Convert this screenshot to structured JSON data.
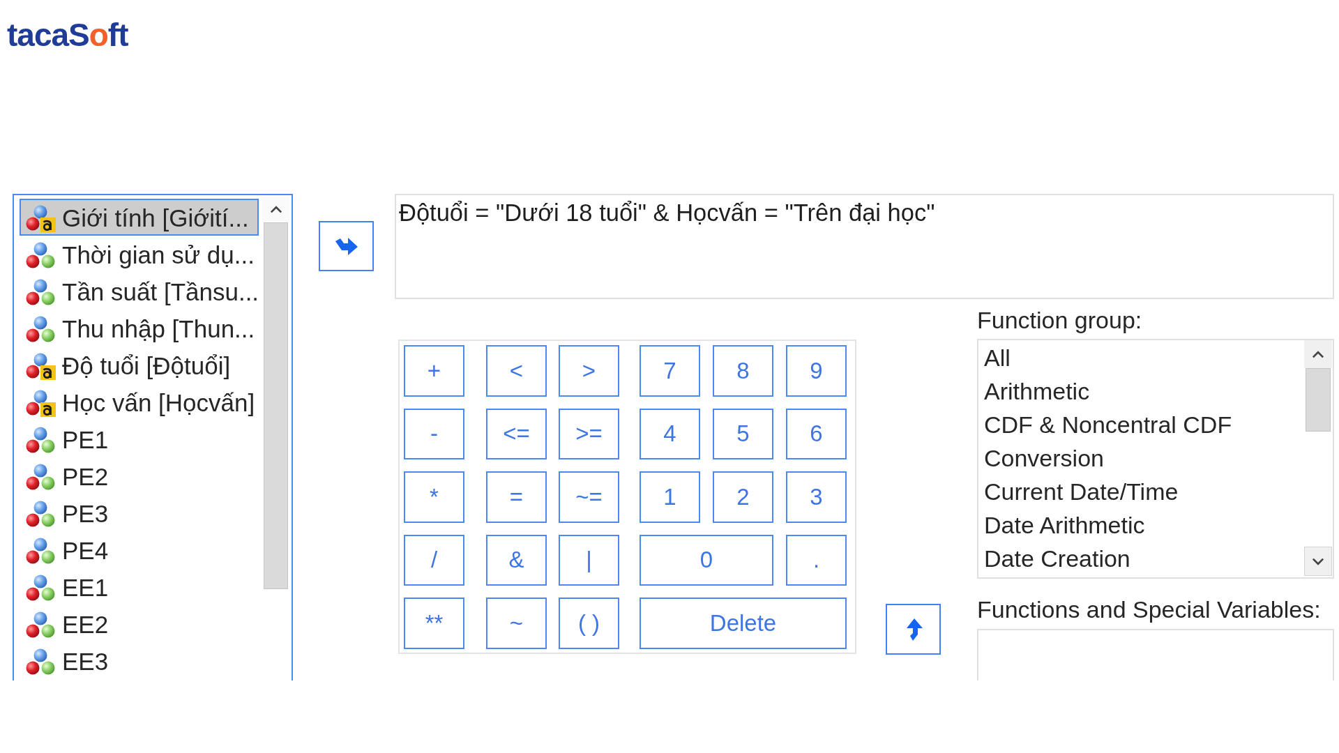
{
  "logo": {
    "text": "tacaSoft"
  },
  "variables": [
    {
      "name": "Giới tính [Giớití...",
      "kind": "string",
      "selected": true
    },
    {
      "name": "Thời gian sử dụ...",
      "kind": "numeric",
      "selected": false
    },
    {
      "name": "Tần suất [Tầnsu...",
      "kind": "numeric",
      "selected": false
    },
    {
      "name": "Thu nhập [Thun...",
      "kind": "numeric",
      "selected": false
    },
    {
      "name": "Độ tuổi [Độtuổi]",
      "kind": "string",
      "selected": false
    },
    {
      "name": "Học vấn [Họcvấn]",
      "kind": "string",
      "selected": false
    },
    {
      "name": "PE1",
      "kind": "numeric",
      "selected": false
    },
    {
      "name": "PE2",
      "kind": "numeric",
      "selected": false
    },
    {
      "name": "PE3",
      "kind": "numeric",
      "selected": false
    },
    {
      "name": "PE4",
      "kind": "numeric",
      "selected": false
    },
    {
      "name": "EE1",
      "kind": "numeric",
      "selected": false
    },
    {
      "name": "EE2",
      "kind": "numeric",
      "selected": false
    },
    {
      "name": "EE3",
      "kind": "numeric",
      "selected": false
    }
  ],
  "expression": {
    "value": "Độtuổi = \"Dưới 18 tuổi\" & Họcvấn = \"Trên đại học\""
  },
  "keypad": {
    "rows": [
      [
        {
          "label": "+",
          "kind": "key"
        },
        {
          "label": "<",
          "kind": "key"
        },
        {
          "label": ">",
          "kind": "key"
        },
        {
          "label": "7",
          "kind": "key"
        },
        {
          "label": "8",
          "kind": "key"
        },
        {
          "label": "9",
          "kind": "key"
        }
      ],
      [
        {
          "label": "-",
          "kind": "key"
        },
        {
          "label": "<=",
          "kind": "key"
        },
        {
          "label": ">=",
          "kind": "key"
        },
        {
          "label": "4",
          "kind": "key"
        },
        {
          "label": "5",
          "kind": "key"
        },
        {
          "label": "6",
          "kind": "key"
        }
      ],
      [
        {
          "label": "*",
          "kind": "key"
        },
        {
          "label": "=",
          "kind": "key"
        },
        {
          "label": "~=",
          "kind": "key"
        },
        {
          "label": "1",
          "kind": "key"
        },
        {
          "label": "2",
          "kind": "key"
        },
        {
          "label": "3",
          "kind": "key"
        }
      ],
      [
        {
          "label": "/",
          "kind": "key"
        },
        {
          "label": "&",
          "kind": "key"
        },
        {
          "label": "|",
          "kind": "key"
        },
        {
          "label": "0",
          "kind": "key"
        },
        {
          "kind": "join_prev"
        },
        {
          "label": ".",
          "kind": "key"
        }
      ],
      [
        {
          "label": "**",
          "kind": "key"
        },
        {
          "label": "~",
          "kind": "key"
        },
        {
          "label": "( )",
          "kind": "key"
        },
        {
          "kind": "join_next"
        },
        {
          "label": "Delete",
          "kind": "key"
        },
        {
          "kind": "join_prev"
        }
      ]
    ]
  },
  "function_group": {
    "label": "Function group:",
    "items": [
      {
        "label": "All",
        "selected": false
      },
      {
        "label": "Arithmetic",
        "selected": false
      },
      {
        "label": "CDF & Noncentral CDF",
        "selected": false
      },
      {
        "label": "Conversion",
        "selected": false
      },
      {
        "label": "Current Date/Time",
        "selected": false
      },
      {
        "label": "Date Arithmetic",
        "selected": false
      },
      {
        "label": "Date Creation",
        "selected": false
      }
    ]
  },
  "functions": {
    "label": "Functions and Special Variables:"
  }
}
